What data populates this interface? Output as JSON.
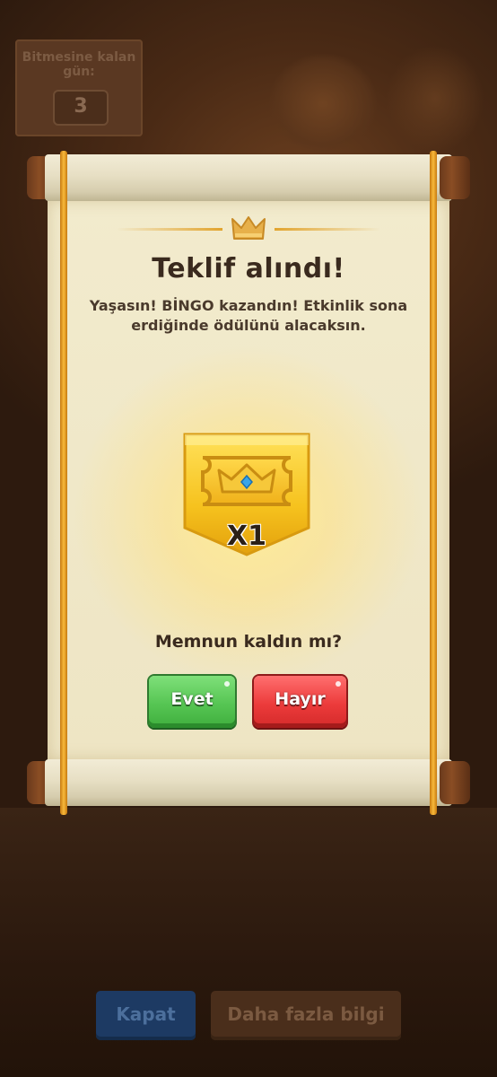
{
  "background": {
    "days_panel": {
      "title": "Bitmesine kalan gün:",
      "value": "3"
    },
    "buttons": {
      "close": "Kapat",
      "more_info": "Daha fazla bilgi"
    }
  },
  "dialog": {
    "title": "Teklif alındı!",
    "message": "Yaşasın! BİNGO kazandın! Etkinlik sona erdiğinde ödülünü alacaksın.",
    "reward": {
      "icon": "crown-ticket-icon",
      "count": "X1"
    },
    "question": "Memnun kaldın mı?",
    "yes_label": "Evet",
    "no_label": "Hayır"
  },
  "colors": {
    "yes_button": "#56c553",
    "no_button": "#ec3b3b",
    "gold": "#f7b437",
    "parchment": "#efe7c6"
  }
}
